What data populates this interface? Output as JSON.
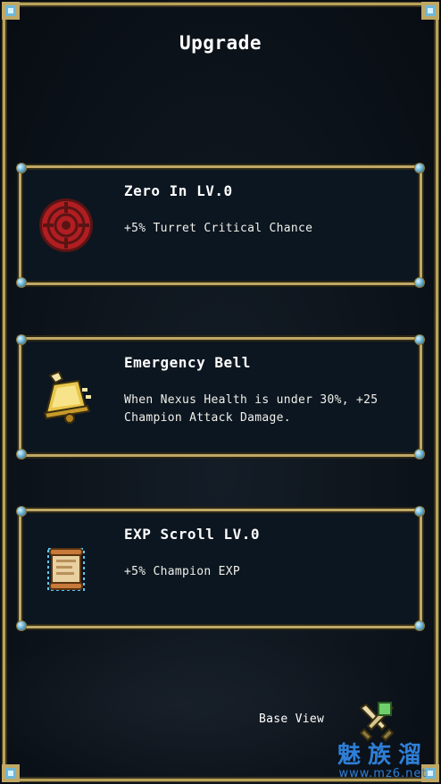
{
  "screen": {
    "title": "Upgrade"
  },
  "upgrades": [
    {
      "name": "Zero In LV.0",
      "description": "+5% Turret Critical Chance",
      "icon": "target-icon"
    },
    {
      "name": "Emergency Bell",
      "description": "When Nexus Health is under 30%, +25 Champion Attack Damage.",
      "icon": "bell-icon"
    },
    {
      "name": "EXP Scroll LV.0",
      "description": "+5% Champion EXP",
      "icon": "scroll-icon"
    }
  ],
  "footer": {
    "base_view_label": "Base View",
    "base_view_icon": "crossed-swords-icon"
  },
  "watermark": {
    "main": "魅族溜",
    "sub": "www.mz6.net"
  },
  "colors": {
    "background": "#0d141c",
    "border_gold": "#bfa865",
    "text": "#ffffff",
    "watermark": "#2e7fd8"
  }
}
